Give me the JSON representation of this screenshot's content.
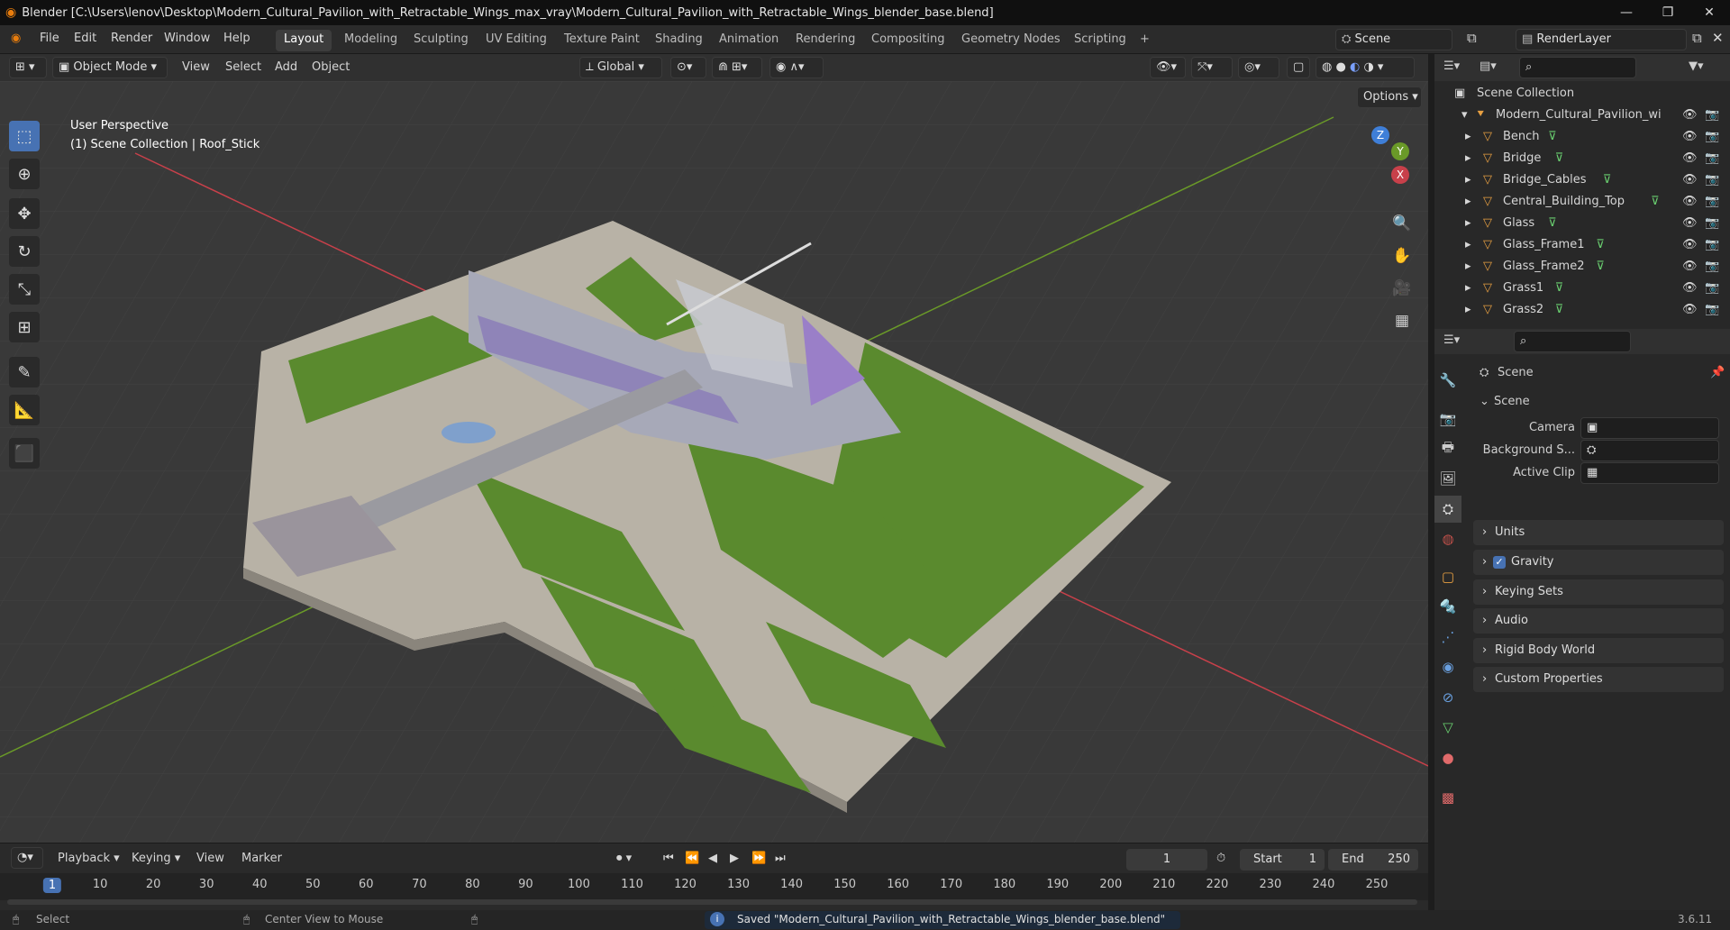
{
  "window": {
    "title": "Blender [C:\\Users\\lenov\\Desktop\\Modern_Cultural_Pavilion_with_Retractable_Wings_max_vray\\Modern_Cultural_Pavilion_with_Retractable_Wings_blender_base.blend]",
    "minimize": "—",
    "maximize": "❐",
    "close": "✕"
  },
  "menu": {
    "file": "File",
    "edit": "Edit",
    "render": "Render",
    "window": "Window",
    "help": "Help"
  },
  "workspaces": [
    "Layout",
    "Modeling",
    "Sculpting",
    "UV Editing",
    "Texture Paint",
    "Shading",
    "Animation",
    "Rendering",
    "Compositing",
    "Geometry Nodes",
    "Scripting"
  ],
  "workspace_add": "+",
  "scene_field": "Scene",
  "renderlayer_field": "RenderLayer",
  "viewport_header": {
    "mode": "Object Mode",
    "view": "View",
    "select": "Select",
    "add": "Add",
    "object": "Object",
    "orientation": "Global",
    "options": "Options"
  },
  "viewport": {
    "perspective": "User Perspective",
    "collection_info": "(1) Scene Collection | Roof_Stick"
  },
  "gizmo": {
    "z": "Z",
    "y": "Y",
    "x": "X"
  },
  "outliner": {
    "root": "Scene Collection",
    "collection": "Modern_Cultural_Pavilion_wi",
    "items": [
      "Bench",
      "Bridge",
      "Bridge_Cables",
      "Central_Building_Top",
      "Glass",
      "Glass_Frame1",
      "Glass_Frame2",
      "Grass1",
      "Grass2"
    ]
  },
  "properties": {
    "header": "Scene",
    "section": "Scene",
    "camera_label": "Camera",
    "background_label": "Background S...",
    "active_clip_label": "Active Clip",
    "panels": [
      "Units",
      "Gravity",
      "Keying Sets",
      "Audio",
      "Rigid Body World",
      "Custom Properties"
    ],
    "gravity_checked": true
  },
  "timeline": {
    "playback": "Playback",
    "keying": "Keying",
    "view": "View",
    "marker": "Marker",
    "current_frame": "1",
    "start_label": "Start",
    "start": "1",
    "end_label": "End",
    "end": "250",
    "ticks": [
      "1",
      "10",
      "20",
      "30",
      "40",
      "50",
      "60",
      "70",
      "80",
      "90",
      "100",
      "110",
      "120",
      "130",
      "140",
      "150",
      "160",
      "170",
      "180",
      "190",
      "200",
      "210",
      "220",
      "230",
      "240",
      "250"
    ]
  },
  "status": {
    "select": "Select",
    "center_view": "Center View to Mouse",
    "message": "Saved \"Modern_Cultural_Pavilion_with_Retractable_Wings_blender_base.blend\"",
    "version": "3.6.11"
  },
  "colors": {
    "accent": "#4772b3",
    "grass": "#5a8a2e",
    "x_axis": "#c8404a",
    "y_axis": "#6a9a28",
    "z_axis": "#3f7fd8"
  }
}
